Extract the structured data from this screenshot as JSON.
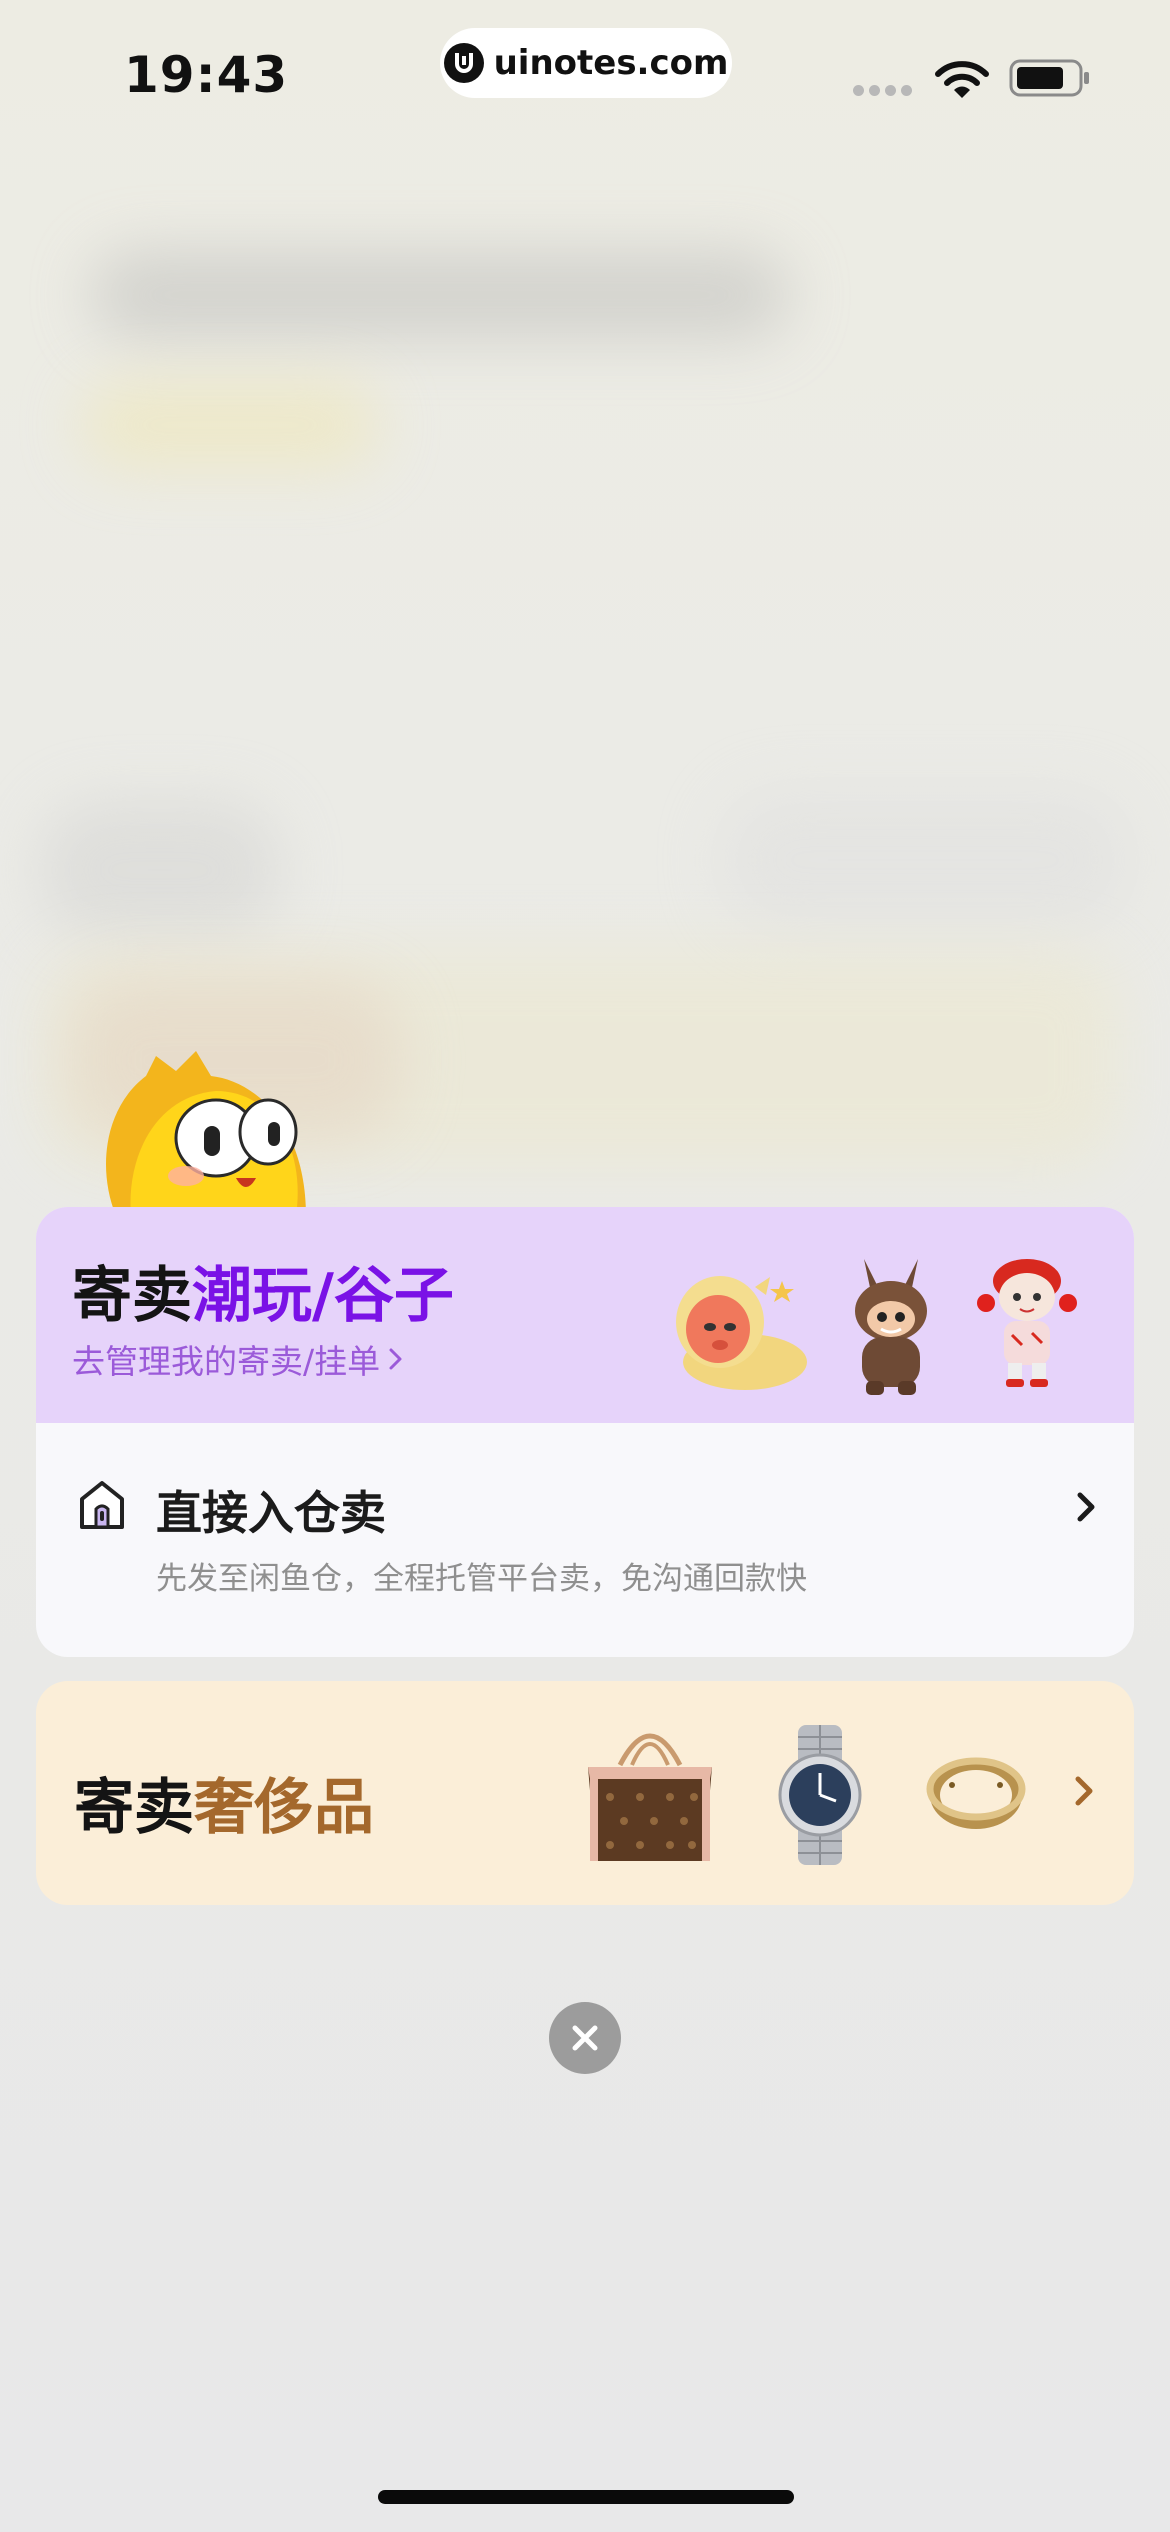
{
  "status_bar": {
    "time": "19:43",
    "url": "uinotes.com",
    "icons": [
      "signal-dots-icon",
      "wifi-icon",
      "battery-icon"
    ]
  },
  "trend_card": {
    "title_prefix": "寄卖",
    "title_accent": "潮玩/谷子",
    "link_text": "去管理我的寄卖/挂单",
    "accent_color": "#7a12e6",
    "header_color": "#e6d3fa",
    "warehouse": {
      "title": "直接入仓卖",
      "subtitle": "先发至闲鱼仓，全程托管平台卖，免沟通回款快"
    }
  },
  "luxury_card": {
    "title_prefix": "寄卖",
    "title_accent": "奢侈品",
    "accent_color": "#a4682c",
    "background_color": "#fbeed8",
    "items": [
      "handbag-icon",
      "wristwatch-icon",
      "ring-icon"
    ]
  },
  "close_button": {
    "icon": "close-icon"
  }
}
